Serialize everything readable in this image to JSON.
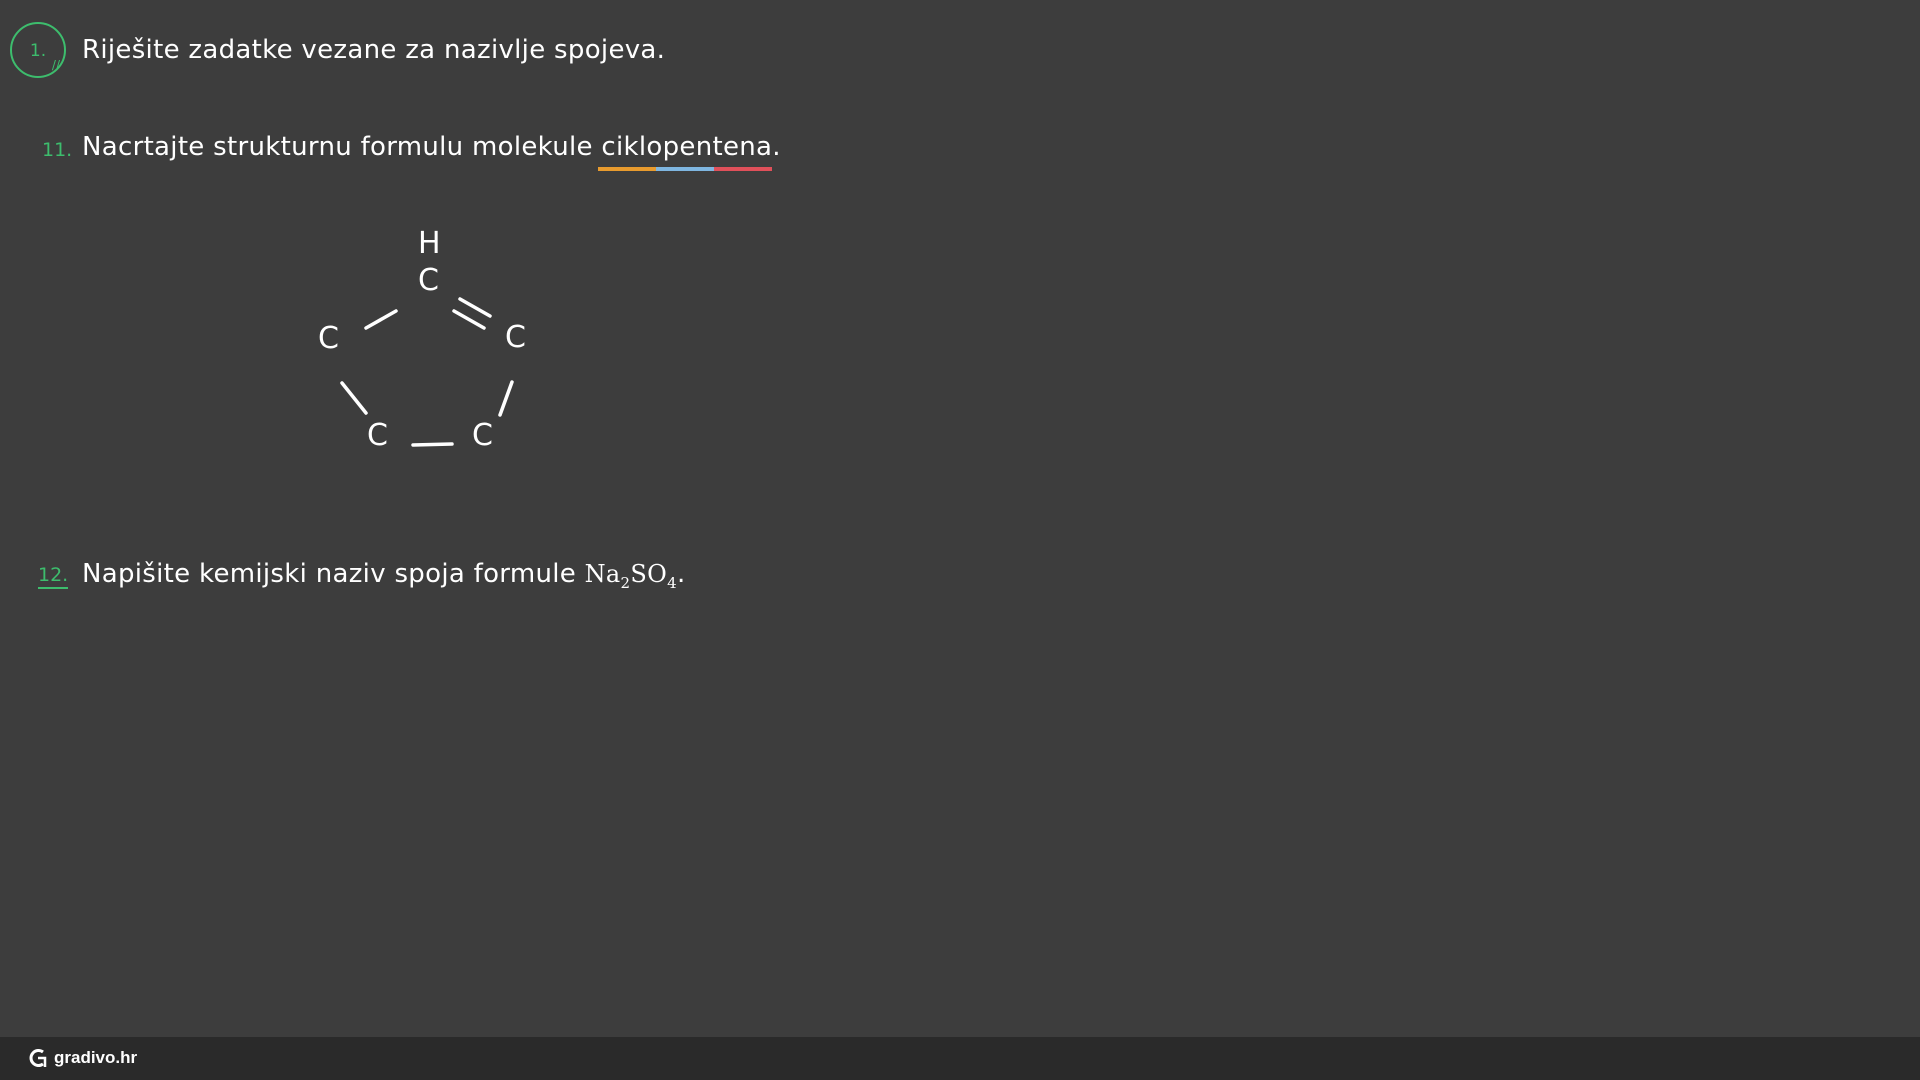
{
  "task": {
    "number": "1.",
    "heading": "Riješite zadatke vezane za nazivlje spojeva."
  },
  "questions": [
    {
      "number": "11.",
      "text_before": "Nacrtajte strukturnu formulu molekule ",
      "underlined_word": "ciklopentena",
      "text_after": ".",
      "underline_colors": [
        "#e89b2e",
        "#7fb6e0",
        "#e0505a"
      ]
    },
    {
      "number": "12.",
      "text_before": "Napišite kemijski naziv spoja formule ",
      "formula": {
        "el1": "Na",
        "sub1": "2",
        "el2": "SO",
        "sub2": "4"
      },
      "text_after": "."
    }
  ],
  "molecule": {
    "h_label": "H",
    "carbon_label": "C",
    "atoms": [
      "H",
      "C",
      "C",
      "C",
      "C",
      "C"
    ]
  },
  "footer": {
    "brand": "gradivo.hr"
  },
  "colors": {
    "background": "#3d3d3d",
    "footer": "#2a2a2a",
    "accent_green": "#3dbd6d",
    "text": "#ffffff"
  }
}
